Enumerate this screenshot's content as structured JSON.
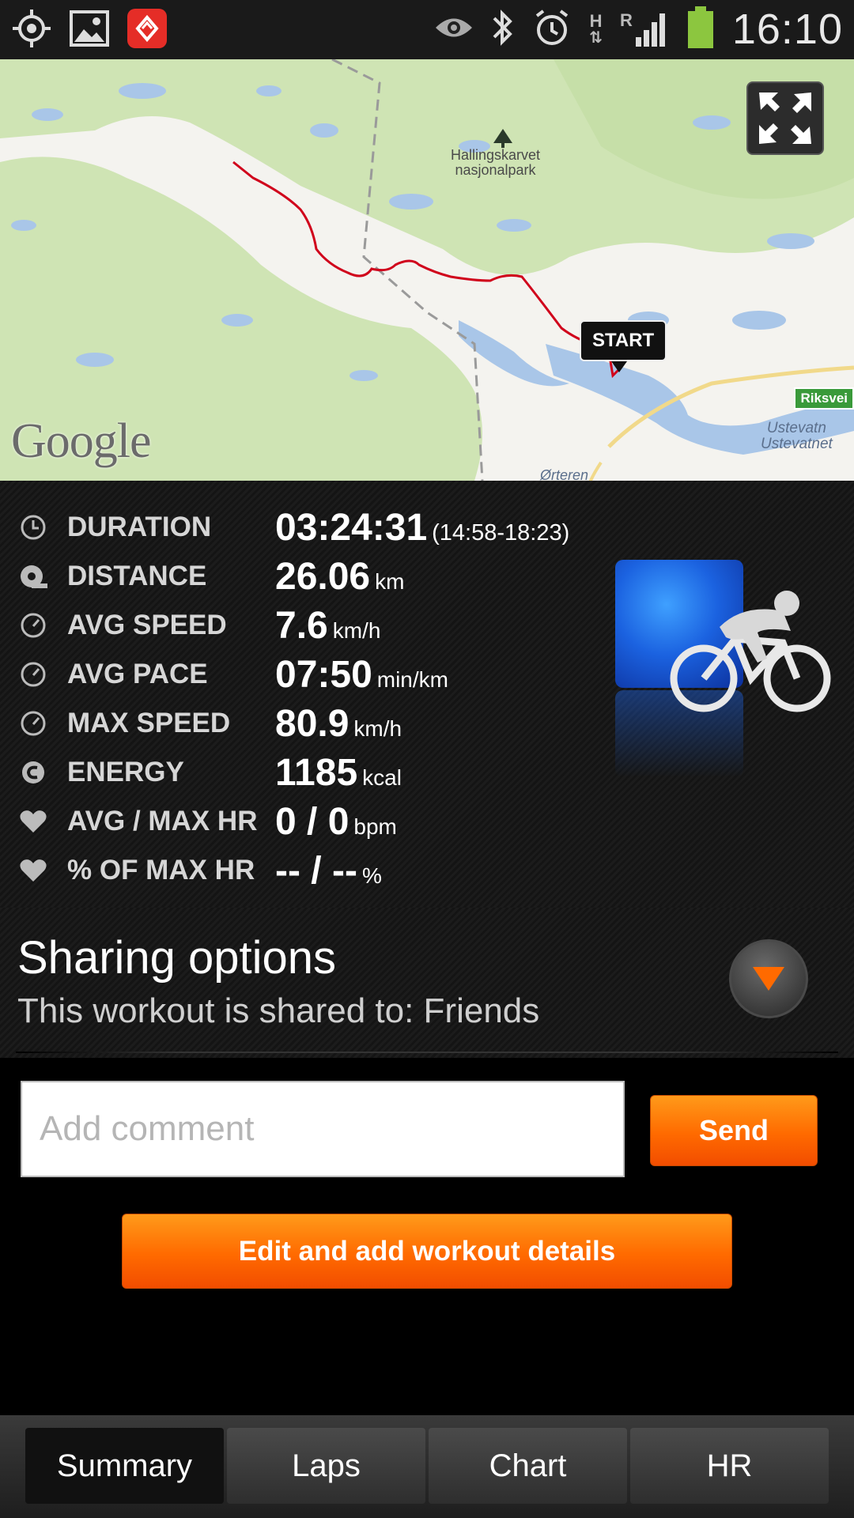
{
  "status_bar": {
    "time": "16:10",
    "network_h": "H",
    "network_r": "R",
    "icons": [
      "gps-icon",
      "gallery-icon",
      "app-icon",
      "eye-icon",
      "bluetooth-icon",
      "alarm-icon",
      "data-arrows-icon",
      "signal-icon",
      "battery-icon"
    ]
  },
  "map": {
    "park_label": "Hallingskarvet\nnasjonalpark",
    "park_line1": "Hallingskarvet",
    "park_line2": "nasjonalpark",
    "start_label": "START",
    "road_label": "Riksvei",
    "lake1": "Ustevatn",
    "lake2": "Ustevatnet",
    "place": "Ørteren",
    "logo": "Google"
  },
  "stats": [
    {
      "label": "DURATION",
      "value": "03:24:31",
      "unit": "(14:58-18:23)",
      "icon": "clock-icon"
    },
    {
      "label": "DISTANCE",
      "value": "26.06",
      "unit": "km",
      "icon": "tape-measure-icon"
    },
    {
      "label": "AVG SPEED",
      "value": "7.6",
      "unit": "km/h",
      "icon": "speedometer-icon"
    },
    {
      "label": "AVG PACE",
      "value": "07:50",
      "unit": "min/km",
      "icon": "speedometer-icon"
    },
    {
      "label": "MAX SPEED",
      "value": "80.9",
      "unit": "km/h",
      "icon": "speedometer-icon"
    },
    {
      "label": "ENERGY",
      "value": "1185",
      "unit": "kcal",
      "icon": "energy-icon"
    },
    {
      "label": "AVG / MAX HR",
      "value": "0 / 0",
      "unit": "bpm",
      "icon": "heart-icon"
    },
    {
      "label": "% OF MAX HR",
      "value": "-- / --",
      "unit": "%",
      "icon": "heart-icon"
    }
  ],
  "sport_icon": "cycling-icon",
  "sharing": {
    "title": "Sharing options",
    "subtitle": "This workout is shared to: Friends"
  },
  "comment": {
    "placeholder": "Add comment",
    "send_label": "Send"
  },
  "edit_label": "Edit and add workout details",
  "tabs": [
    {
      "label": "Summary",
      "active": true
    },
    {
      "label": "Laps",
      "active": false
    },
    {
      "label": "Chart",
      "active": false
    },
    {
      "label": "HR",
      "active": false
    }
  ],
  "colors": {
    "accent": "#ff6a00",
    "route": "#d0021b",
    "park_green": "#cbe3b0",
    "water": "#a9c6e8"
  }
}
